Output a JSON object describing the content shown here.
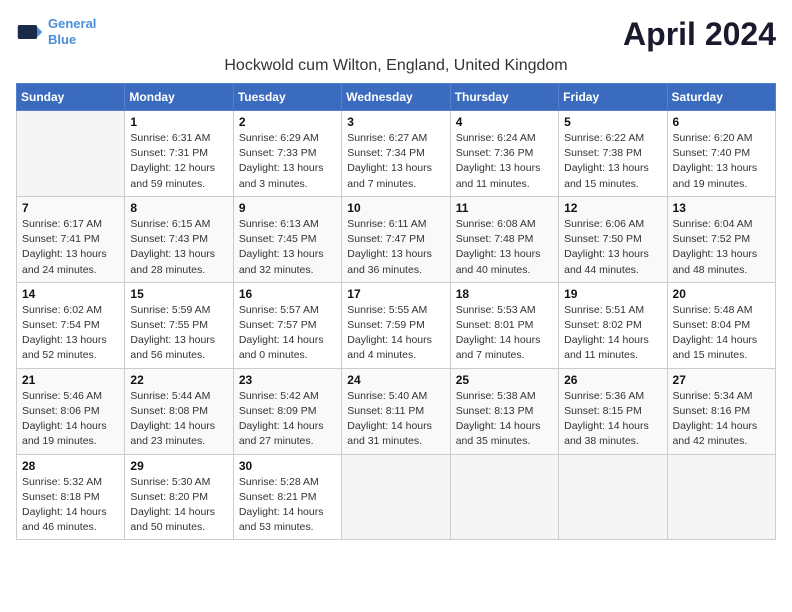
{
  "logo": {
    "line1": "General",
    "line2": "Blue",
    "arrow_color": "#4a90d9"
  },
  "title": "April 2024",
  "subtitle": "Hockwold cum Wilton, England, United Kingdom",
  "weekdays": [
    "Sunday",
    "Monday",
    "Tuesday",
    "Wednesday",
    "Thursday",
    "Friday",
    "Saturday"
  ],
  "weeks": [
    [
      {
        "num": "",
        "sunrise": "",
        "sunset": "",
        "daylight": ""
      },
      {
        "num": "1",
        "sunrise": "Sunrise: 6:31 AM",
        "sunset": "Sunset: 7:31 PM",
        "daylight": "Daylight: 12 hours and 59 minutes."
      },
      {
        "num": "2",
        "sunrise": "Sunrise: 6:29 AM",
        "sunset": "Sunset: 7:33 PM",
        "daylight": "Daylight: 13 hours and 3 minutes."
      },
      {
        "num": "3",
        "sunrise": "Sunrise: 6:27 AM",
        "sunset": "Sunset: 7:34 PM",
        "daylight": "Daylight: 13 hours and 7 minutes."
      },
      {
        "num": "4",
        "sunrise": "Sunrise: 6:24 AM",
        "sunset": "Sunset: 7:36 PM",
        "daylight": "Daylight: 13 hours and 11 minutes."
      },
      {
        "num": "5",
        "sunrise": "Sunrise: 6:22 AM",
        "sunset": "Sunset: 7:38 PM",
        "daylight": "Daylight: 13 hours and 15 minutes."
      },
      {
        "num": "6",
        "sunrise": "Sunrise: 6:20 AM",
        "sunset": "Sunset: 7:40 PM",
        "daylight": "Daylight: 13 hours and 19 minutes."
      }
    ],
    [
      {
        "num": "7",
        "sunrise": "Sunrise: 6:17 AM",
        "sunset": "Sunset: 7:41 PM",
        "daylight": "Daylight: 13 hours and 24 minutes."
      },
      {
        "num": "8",
        "sunrise": "Sunrise: 6:15 AM",
        "sunset": "Sunset: 7:43 PM",
        "daylight": "Daylight: 13 hours and 28 minutes."
      },
      {
        "num": "9",
        "sunrise": "Sunrise: 6:13 AM",
        "sunset": "Sunset: 7:45 PM",
        "daylight": "Daylight: 13 hours and 32 minutes."
      },
      {
        "num": "10",
        "sunrise": "Sunrise: 6:11 AM",
        "sunset": "Sunset: 7:47 PM",
        "daylight": "Daylight: 13 hours and 36 minutes."
      },
      {
        "num": "11",
        "sunrise": "Sunrise: 6:08 AM",
        "sunset": "Sunset: 7:48 PM",
        "daylight": "Daylight: 13 hours and 40 minutes."
      },
      {
        "num": "12",
        "sunrise": "Sunrise: 6:06 AM",
        "sunset": "Sunset: 7:50 PM",
        "daylight": "Daylight: 13 hours and 44 minutes."
      },
      {
        "num": "13",
        "sunrise": "Sunrise: 6:04 AM",
        "sunset": "Sunset: 7:52 PM",
        "daylight": "Daylight: 13 hours and 48 minutes."
      }
    ],
    [
      {
        "num": "14",
        "sunrise": "Sunrise: 6:02 AM",
        "sunset": "Sunset: 7:54 PM",
        "daylight": "Daylight: 13 hours and 52 minutes."
      },
      {
        "num": "15",
        "sunrise": "Sunrise: 5:59 AM",
        "sunset": "Sunset: 7:55 PM",
        "daylight": "Daylight: 13 hours and 56 minutes."
      },
      {
        "num": "16",
        "sunrise": "Sunrise: 5:57 AM",
        "sunset": "Sunset: 7:57 PM",
        "daylight": "Daylight: 14 hours and 0 minutes."
      },
      {
        "num": "17",
        "sunrise": "Sunrise: 5:55 AM",
        "sunset": "Sunset: 7:59 PM",
        "daylight": "Daylight: 14 hours and 4 minutes."
      },
      {
        "num": "18",
        "sunrise": "Sunrise: 5:53 AM",
        "sunset": "Sunset: 8:01 PM",
        "daylight": "Daylight: 14 hours and 7 minutes."
      },
      {
        "num": "19",
        "sunrise": "Sunrise: 5:51 AM",
        "sunset": "Sunset: 8:02 PM",
        "daylight": "Daylight: 14 hours and 11 minutes."
      },
      {
        "num": "20",
        "sunrise": "Sunrise: 5:48 AM",
        "sunset": "Sunset: 8:04 PM",
        "daylight": "Daylight: 14 hours and 15 minutes."
      }
    ],
    [
      {
        "num": "21",
        "sunrise": "Sunrise: 5:46 AM",
        "sunset": "Sunset: 8:06 PM",
        "daylight": "Daylight: 14 hours and 19 minutes."
      },
      {
        "num": "22",
        "sunrise": "Sunrise: 5:44 AM",
        "sunset": "Sunset: 8:08 PM",
        "daylight": "Daylight: 14 hours and 23 minutes."
      },
      {
        "num": "23",
        "sunrise": "Sunrise: 5:42 AM",
        "sunset": "Sunset: 8:09 PM",
        "daylight": "Daylight: 14 hours and 27 minutes."
      },
      {
        "num": "24",
        "sunrise": "Sunrise: 5:40 AM",
        "sunset": "Sunset: 8:11 PM",
        "daylight": "Daylight: 14 hours and 31 minutes."
      },
      {
        "num": "25",
        "sunrise": "Sunrise: 5:38 AM",
        "sunset": "Sunset: 8:13 PM",
        "daylight": "Daylight: 14 hours and 35 minutes."
      },
      {
        "num": "26",
        "sunrise": "Sunrise: 5:36 AM",
        "sunset": "Sunset: 8:15 PM",
        "daylight": "Daylight: 14 hours and 38 minutes."
      },
      {
        "num": "27",
        "sunrise": "Sunrise: 5:34 AM",
        "sunset": "Sunset: 8:16 PM",
        "daylight": "Daylight: 14 hours and 42 minutes."
      }
    ],
    [
      {
        "num": "28",
        "sunrise": "Sunrise: 5:32 AM",
        "sunset": "Sunset: 8:18 PM",
        "daylight": "Daylight: 14 hours and 46 minutes."
      },
      {
        "num": "29",
        "sunrise": "Sunrise: 5:30 AM",
        "sunset": "Sunset: 8:20 PM",
        "daylight": "Daylight: 14 hours and 50 minutes."
      },
      {
        "num": "30",
        "sunrise": "Sunrise: 5:28 AM",
        "sunset": "Sunset: 8:21 PM",
        "daylight": "Daylight: 14 hours and 53 minutes."
      },
      {
        "num": "",
        "sunrise": "",
        "sunset": "",
        "daylight": ""
      },
      {
        "num": "",
        "sunrise": "",
        "sunset": "",
        "daylight": ""
      },
      {
        "num": "",
        "sunrise": "",
        "sunset": "",
        "daylight": ""
      },
      {
        "num": "",
        "sunrise": "",
        "sunset": "",
        "daylight": ""
      }
    ]
  ]
}
